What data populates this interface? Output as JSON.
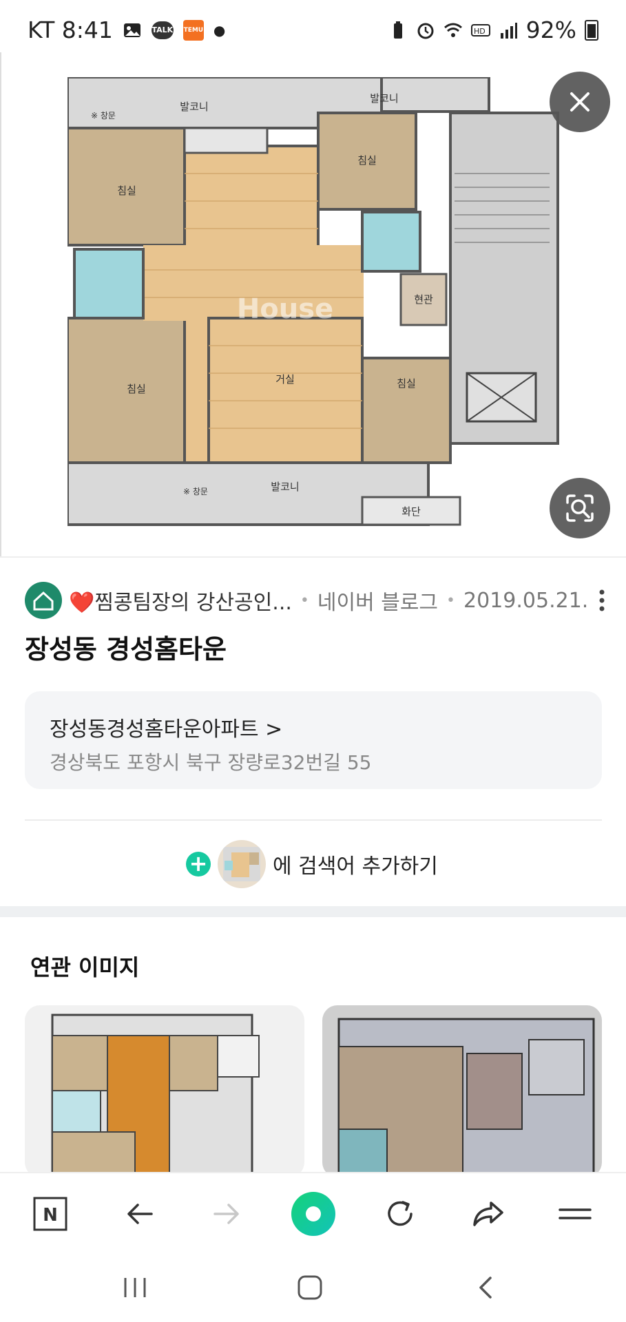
{
  "status_bar": {
    "carrier_time": "KT 8:41",
    "talk_label": "TALK",
    "temu_label": "TEMU",
    "battery": "92%"
  },
  "plan_labels": {
    "balcony_top_left": "발코니",
    "balcony_top_right": "발코니",
    "window_top": "※ 창문",
    "bedroom_1": "침실",
    "bedroom_2": "침실",
    "bedroom_3": "침실",
    "bedroom_4": "침실",
    "living": "거실",
    "entrance": "현관",
    "balcony_bottom": "발코니",
    "window_bottom": "※ 창문",
    "flower_bed": "화단",
    "watermark": "House"
  },
  "source": {
    "name": "❤️찜콩팀장의 강산공인...",
    "platform": "네이버 블로그",
    "date": "2019.05.21."
  },
  "title": "장성동 경성홈타운",
  "place": {
    "name": "장성동경성홈타운아파트 >",
    "address": "경상북도 포항시 북구 장량로32번길 55"
  },
  "add_search": {
    "label": "에 검색어 추가하기"
  },
  "related": {
    "title": "연관 이미지"
  },
  "nav": {
    "n_label": "N"
  },
  "colors": {
    "accent_green": "#16c9a0",
    "floor_wood": "#e8c48f",
    "room_beige": "#c9b38f"
  }
}
